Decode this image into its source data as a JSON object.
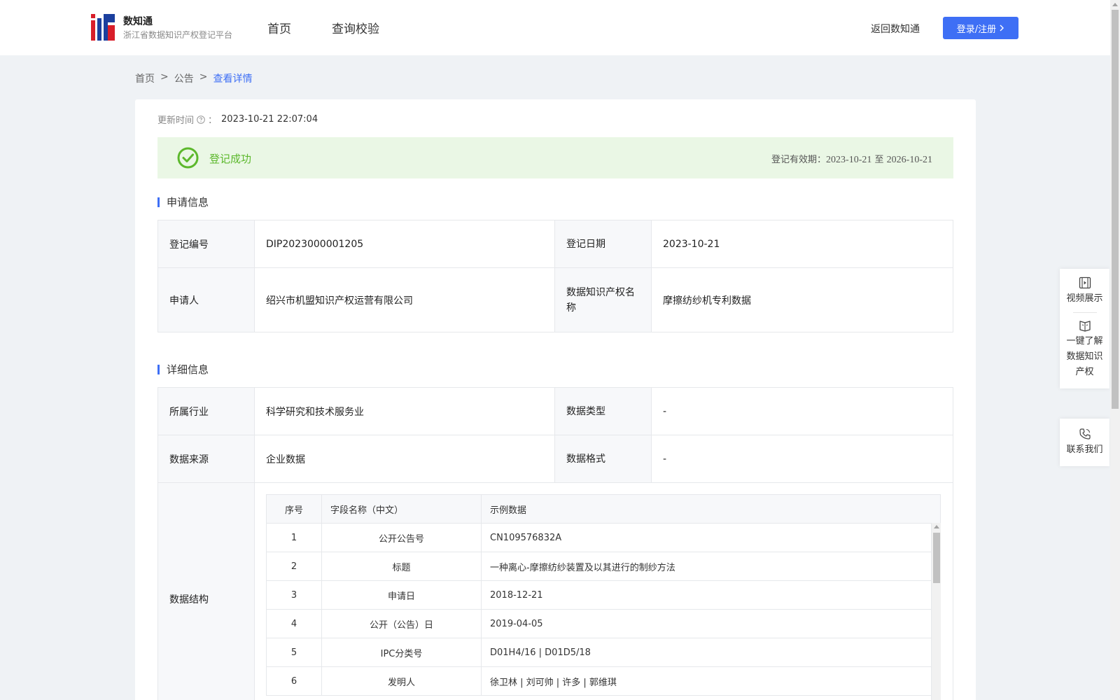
{
  "header": {
    "logo_title": "数知通",
    "logo_subtitle": "浙江省数据知识产权登记平台",
    "nav": [
      "首页",
      "查询校验"
    ],
    "back_link": "返回数知通",
    "login_label": "登录/注册"
  },
  "breadcrumb": {
    "items": [
      "首页",
      "公告",
      "查看详情"
    ],
    "separator": ">"
  },
  "update": {
    "label": "更新时间",
    "colon": "：",
    "value": "2023-10-21 22:07:04"
  },
  "status": {
    "text": "登记成功",
    "validity_label": "登记有效期：",
    "validity_start": "2023-10-21",
    "validity_to": "至",
    "validity_end": "2026-10-21",
    "color": "#5cb82c"
  },
  "application": {
    "title": "申请信息",
    "reg_no_label": "登记编号",
    "reg_no": "DIP2023000001205",
    "reg_date_label": "登记日期",
    "reg_date": "2023-10-21",
    "applicant_label": "申请人",
    "applicant": "绍兴市机盟知识产权运营有限公司",
    "ip_name_label": "数据知识产权名称",
    "ip_name": "摩擦纺纱机专利数据"
  },
  "details": {
    "title": "详细信息",
    "industry_label": "所属行业",
    "industry": "科学研究和技术服务业",
    "data_type_label": "数据类型",
    "data_type": "-",
    "source_label": "数据来源",
    "source": "企业数据",
    "format_label": "数据格式",
    "format": "-",
    "structure_label": "数据结构",
    "structure_headers": [
      "序号",
      "字段名称（中文）",
      "示例数据"
    ],
    "structure_rows": [
      {
        "no": "1",
        "name": "公开公告号",
        "sample": "CN109576832A"
      },
      {
        "no": "2",
        "name": "标题",
        "sample": "一种离心-摩擦纺纱装置及以其进行的制纱方法"
      },
      {
        "no": "3",
        "name": "申请日",
        "sample": "2018-12-21"
      },
      {
        "no": "4",
        "name": "公开（公告）日",
        "sample": "2019-04-05"
      },
      {
        "no": "5",
        "name": "IPC分类号",
        "sample": "D01H4/16 | D01D5/18"
      },
      {
        "no": "6",
        "name": "发明人",
        "sample": "徐卫林 | 刘可帅 | 许多 | 郭维琪"
      }
    ]
  },
  "float_panel": {
    "video": "视频展示",
    "learn_line1": "一键了解",
    "learn_line2": "数据知识",
    "learn_line3": "产权",
    "contact": "联系我们"
  },
  "colors": {
    "primary": "#3e6ff5",
    "success": "#5cb82c",
    "success_bg": "#eaf7e5"
  }
}
